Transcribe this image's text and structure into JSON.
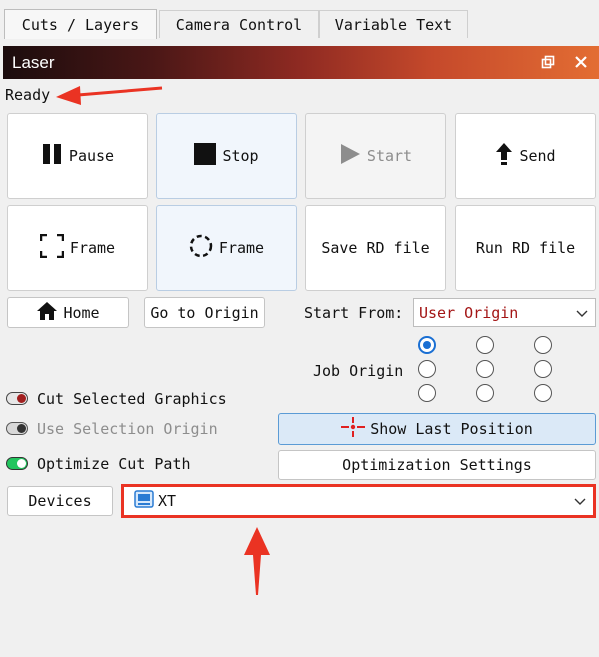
{
  "tabs": [
    {
      "label": "Cuts / Layers"
    },
    {
      "label": "Camera Control"
    },
    {
      "label": "Variable Text"
    }
  ],
  "panel": {
    "title": "Laser"
  },
  "status": "Ready",
  "buttons": {
    "pause": "Pause",
    "stop": "Stop",
    "start": "Start",
    "send": "Send",
    "frame_square": "Frame",
    "frame_circle": "Frame",
    "save_rd": "Save RD file",
    "run_rd": "Run RD file",
    "home": "Home",
    "go_origin": "Go to Origin",
    "show_last": "Show Last Position",
    "opt_settings": "Optimization Settings",
    "devices": "Devices"
  },
  "start_from": {
    "label": "Start From:",
    "value": "User Origin"
  },
  "job_origin": {
    "label": "Job Origin",
    "selected_index": 0
  },
  "options": {
    "cut_selected": {
      "label": "Cut Selected Graphics",
      "state": "off"
    },
    "use_selection_origin": {
      "label": "Use Selection Origin",
      "state": "disabled"
    },
    "optimize_cut_path": {
      "label": "Optimize Cut Path",
      "state": "on"
    }
  },
  "device": {
    "value": "XT"
  },
  "colors": {
    "accent": "#1a6fd3",
    "annotation": "#ea3323",
    "toggle_on": "#22c55e",
    "toggle_off": "#a11f1f"
  }
}
